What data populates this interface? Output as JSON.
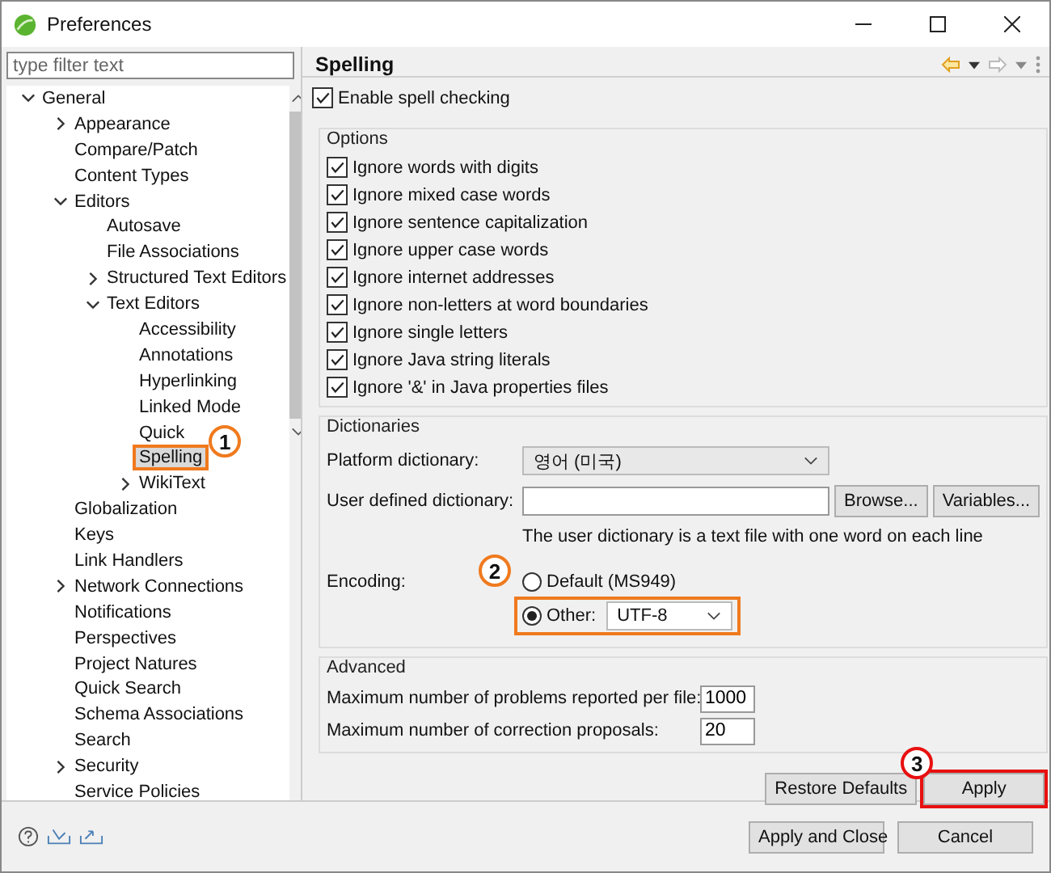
{
  "window": {
    "title": "Preferences"
  },
  "filter": {
    "placeholder": "type filter text"
  },
  "tree": [
    {
      "label": "General",
      "expanded": true,
      "selected": false,
      "children": [
        {
          "label": "Appearance",
          "expanded": false,
          "selected": false
        },
        {
          "label": "Compare/Patch",
          "selected": false
        },
        {
          "label": "Content Types",
          "selected": false
        },
        {
          "label": "Editors",
          "expanded": true,
          "selected": false,
          "children": [
            {
              "label": "Autosave",
              "selected": false
            },
            {
              "label": "File Associations",
              "selected": false
            },
            {
              "label": "Structured Text Editors",
              "expanded": false,
              "selected": false
            },
            {
              "label": "Text Editors",
              "expanded": true,
              "selected": false,
              "children": [
                {
                  "label": "Accessibility",
                  "selected": false
                },
                {
                  "label": "Annotations",
                  "selected": false
                },
                {
                  "label": "Hyperlinking",
                  "selected": false
                },
                {
                  "label": "Linked Mode",
                  "selected": false
                },
                {
                  "label": "Quick",
                  "selected": false
                },
                {
                  "label": "Spelling",
                  "selected": true,
                  "callout": {
                    "number": "1",
                    "color": "#f07a1e"
                  }
                },
                {
                  "label": "WikiText",
                  "expanded": false,
                  "selected": false
                }
              ]
            }
          ]
        },
        {
          "label": "Globalization",
          "selected": false
        },
        {
          "label": "Keys",
          "selected": false
        },
        {
          "label": "Link Handlers",
          "selected": false
        },
        {
          "label": "Network Connections",
          "expanded": false,
          "selected": false
        },
        {
          "label": "Notifications",
          "selected": false
        },
        {
          "label": "Perspectives",
          "selected": false
        },
        {
          "label": "Project Natures",
          "selected": false
        },
        {
          "label": "Quick Search",
          "selected": false
        },
        {
          "label": "Schema Associations",
          "selected": false
        },
        {
          "label": "Search",
          "selected": false
        },
        {
          "label": "Security",
          "expanded": false,
          "selected": false
        },
        {
          "label": "Service Policies",
          "selected": false
        }
      ]
    }
  ],
  "page": {
    "title": "Spelling",
    "enable": {
      "label": "Enable spell checking",
      "checked": true
    },
    "options": {
      "title": "Options",
      "items": [
        {
          "label": "Ignore words with digits",
          "checked": true
        },
        {
          "label": "Ignore mixed case words",
          "checked": true
        },
        {
          "label": "Ignore sentence capitalization",
          "checked": true
        },
        {
          "label": "Ignore upper case words",
          "checked": true
        },
        {
          "label": "Ignore internet addresses",
          "checked": true
        },
        {
          "label": "Ignore non-letters at word boundaries",
          "checked": true
        },
        {
          "label": "Ignore single letters",
          "checked": true
        },
        {
          "label": "Ignore Java string literals",
          "checked": true
        },
        {
          "label": "Ignore '&' in Java properties files",
          "checked": true
        }
      ]
    },
    "dictionaries": {
      "title": "Dictionaries",
      "platform_label": "Platform dictionary:",
      "platform_value": "영어 (미국)",
      "user_label": "User defined dictionary:",
      "browse": "Browse...",
      "variables": "Variables...",
      "hint": "The user dictionary is a text file with one word on each line",
      "encoding_label": "Encoding:",
      "encodings": [
        {
          "label": "Default (MS949)",
          "selected": false
        },
        {
          "label": "Other:",
          "selected": true,
          "value": "UTF-8",
          "callout": {
            "number": "2",
            "color": "#f07a1e"
          }
        }
      ]
    },
    "advanced": {
      "title": "Advanced",
      "fields": [
        {
          "label": "Maximum number of problems reported per file:",
          "value": "1000"
        },
        {
          "label": "Maximum number of correction proposals:",
          "value": "20"
        }
      ]
    },
    "restore": "Restore Defaults",
    "apply": {
      "label": "Apply",
      "callout": {
        "number": "3",
        "color": "#e81010"
      }
    }
  },
  "buttons": [
    "Apply and Close",
    "Cancel"
  ]
}
